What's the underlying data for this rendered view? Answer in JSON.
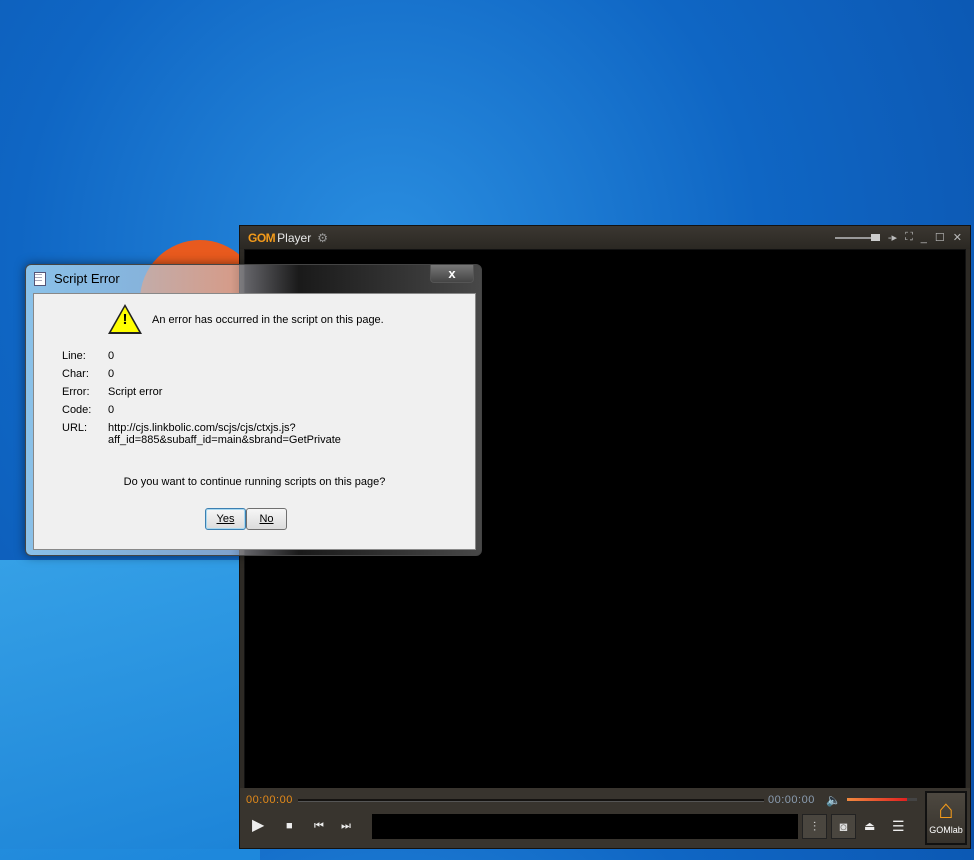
{
  "player": {
    "logo": "GOM",
    "title": "Player",
    "time_current": "00:00:00",
    "time_total": "00:00:00",
    "home_label": "GOMlab",
    "accent": "#f39a1a",
    "volume_fraction": 0.85
  },
  "dialog": {
    "title": "Script Error",
    "close": "x",
    "message": "An error has occurred in the script on this page.",
    "fields": [
      {
        "label": "Line:",
        "value": "0"
      },
      {
        "label": "Char:",
        "value": "0"
      },
      {
        "label": "Error:",
        "value": "Script error"
      },
      {
        "label": "Code:",
        "value": "0"
      },
      {
        "label": "URL:",
        "value": "http://cjs.linkbolic.com/scjs/cjs/ctxjs.js?",
        "value2": "aff_id=885&subaff_id=main&sbrand=GetPrivate"
      }
    ],
    "question": "Do you want to continue running scripts on this page?",
    "yes": "Yes",
    "no": "No"
  }
}
